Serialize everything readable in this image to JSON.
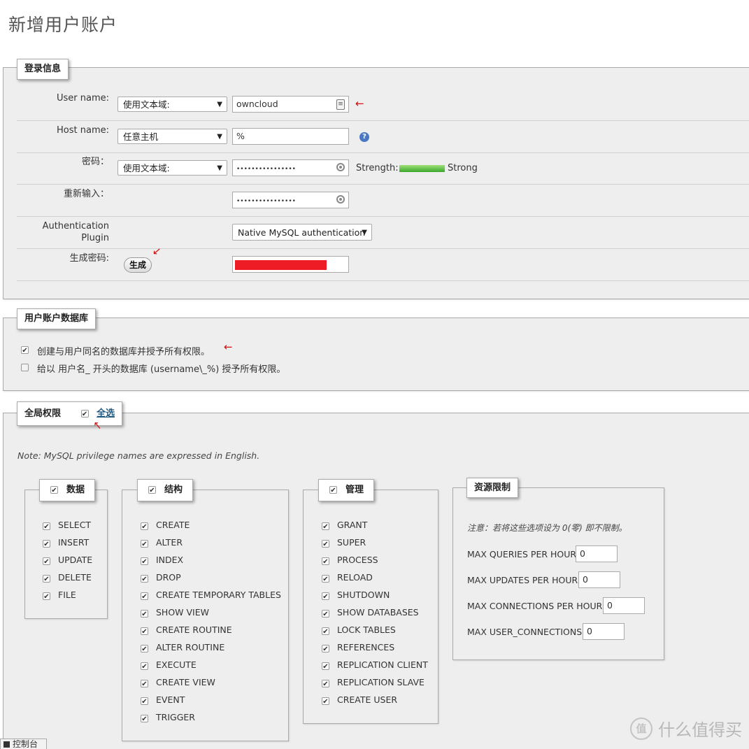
{
  "page_title": "新增用户账户",
  "login": {
    "legend": "登录信息",
    "username": {
      "label": "User name:",
      "select": "使用文本域:",
      "value": "owncloud"
    },
    "hostname": {
      "label": "Host name:",
      "select": "任意主机",
      "value": "%"
    },
    "password": {
      "label": "密码：",
      "select": "使用文本域:",
      "value": "••••••••••••••••",
      "strength_label": "Strength:",
      "strength_text": "Strong"
    },
    "retype": {
      "label": "重新输入：",
      "value": "••••••••••••••••"
    },
    "auth_plugin": {
      "label_line1": "Authentication",
      "label_line2": "Plugin",
      "select": "Native MySQL authentication"
    },
    "generate": {
      "label": "生成密码:",
      "button": "生成"
    }
  },
  "userdb": {
    "legend": "用户账户数据库",
    "opt1": "创建与用户同名的数据库并授予所有权限。",
    "opt2": "给以 用户名_ 开头的数据库 (username\\_%) 授予所有权限。"
  },
  "global": {
    "legend": "全局权限",
    "select_all": "全选",
    "note": "Note: MySQL privilege names are expressed in English."
  },
  "groups": {
    "data": {
      "legend": "数据",
      "items": [
        "SELECT",
        "INSERT",
        "UPDATE",
        "DELETE",
        "FILE"
      ]
    },
    "structure": {
      "legend": "结构",
      "items": [
        "CREATE",
        "ALTER",
        "INDEX",
        "DROP",
        "CREATE TEMPORARY TABLES",
        "SHOW VIEW",
        "CREATE ROUTINE",
        "ALTER ROUTINE",
        "EXECUTE",
        "CREATE VIEW",
        "EVENT",
        "TRIGGER"
      ]
    },
    "admin": {
      "legend": "管理",
      "items": [
        "GRANT",
        "SUPER",
        "PROCESS",
        "RELOAD",
        "SHUTDOWN",
        "SHOW DATABASES",
        "LOCK TABLES",
        "REFERENCES",
        "REPLICATION CLIENT",
        "REPLICATION SLAVE",
        "CREATE USER"
      ]
    }
  },
  "resource": {
    "legend": "资源限制",
    "note": "注意：若将这些选项设为 0(零) 即不限制。",
    "rows": [
      {
        "label": "MAX QUERIES PER HOUR",
        "value": "0"
      },
      {
        "label": "MAX UPDATES PER HOUR",
        "value": "0"
      },
      {
        "label": "MAX CONNECTIONS PER HOUR",
        "value": "0"
      },
      {
        "label": "MAX USER_CONNECTIONS",
        "value": "0"
      }
    ]
  },
  "console_tab": "控制台",
  "watermark": "什么值得买"
}
